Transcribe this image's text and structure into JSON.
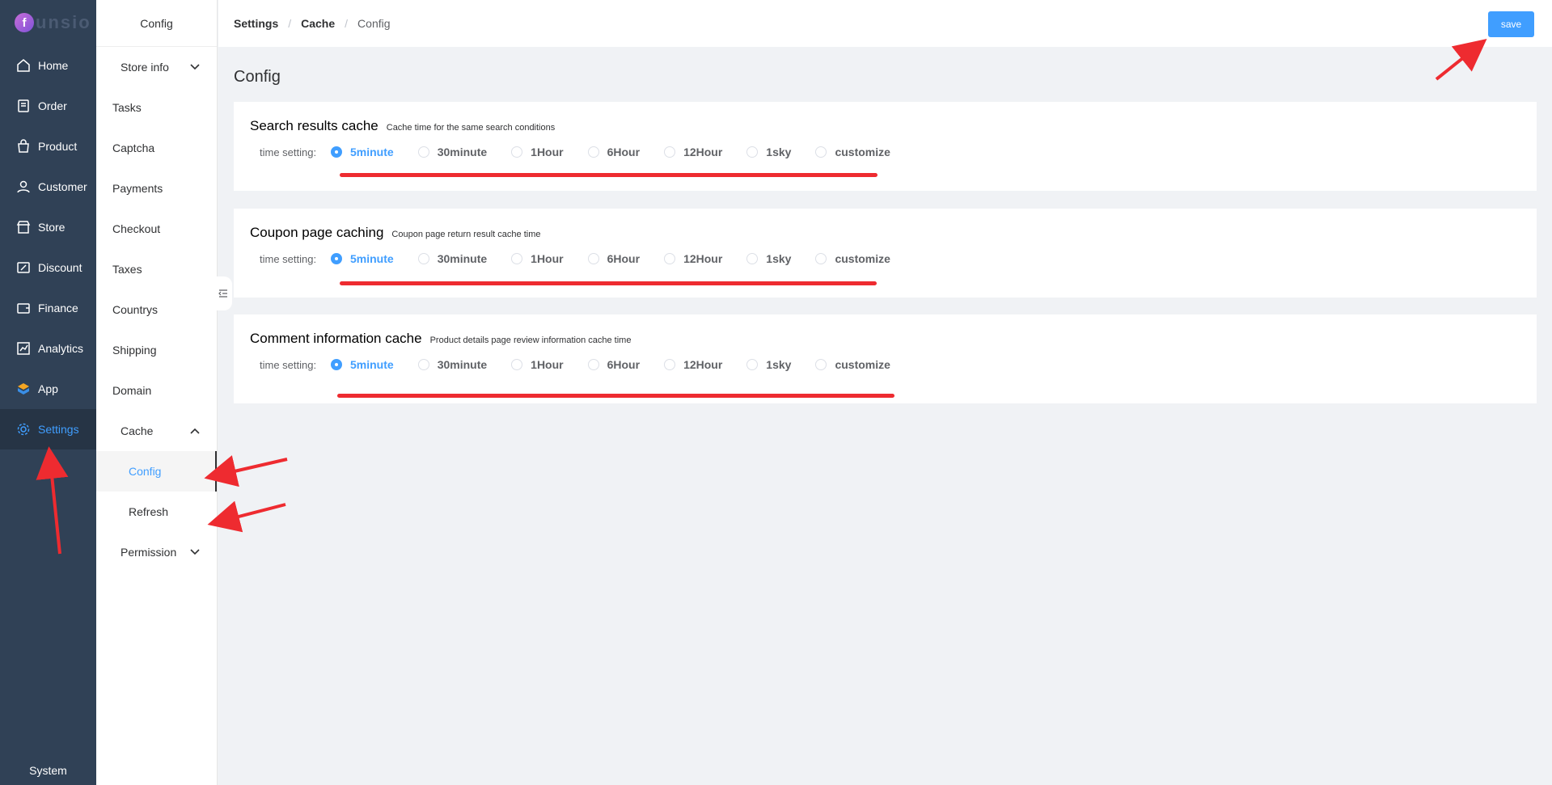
{
  "logo": {
    "mark": "f",
    "text": "unsio"
  },
  "nav": {
    "items": [
      {
        "label": "Home",
        "icon": "home-icon"
      },
      {
        "label": "Order",
        "icon": "order-icon"
      },
      {
        "label": "Product",
        "icon": "bag-icon"
      },
      {
        "label": "Customer",
        "icon": "user-icon"
      },
      {
        "label": "Store",
        "icon": "store-icon"
      },
      {
        "label": "Discount",
        "icon": "discount-icon"
      },
      {
        "label": "Finance",
        "icon": "wallet-icon"
      },
      {
        "label": "Analytics",
        "icon": "chart-icon"
      },
      {
        "label": "App",
        "icon": "app-icon"
      },
      {
        "label": "Settings",
        "icon": "gear-icon",
        "active": true
      }
    ],
    "system": "System"
  },
  "subnav": {
    "title": "Config",
    "store_info": "Store info",
    "items": [
      "Tasks",
      "Captcha",
      "Payments",
      "Checkout",
      "Taxes",
      "Countrys",
      "Shipping",
      "Domain"
    ],
    "cache": "Cache",
    "cache_children": [
      "Config",
      "Refresh"
    ],
    "permission": "Permission"
  },
  "breadcrumb": {
    "a": "Settings",
    "b": "Cache",
    "c": "Config"
  },
  "save_label": "save",
  "page_title": "Config",
  "options": [
    "5minute",
    "30minute",
    "1Hour",
    "6Hour",
    "12Hour",
    "1sky",
    "customize"
  ],
  "time_label": "time setting:",
  "cards": [
    {
      "title": "Search results cache",
      "desc": "Cache time for the same search conditions",
      "selected": "5minute"
    },
    {
      "title": "Coupon page caching",
      "desc": "Coupon page return result cache time",
      "selected": "5minute"
    },
    {
      "title": "Comment information cache",
      "desc": "Product details page review information cache time",
      "selected": "5minute"
    }
  ],
  "colors": {
    "accent": "#409eff",
    "nav_bg": "#304156",
    "annotation": "#ee2b30"
  }
}
